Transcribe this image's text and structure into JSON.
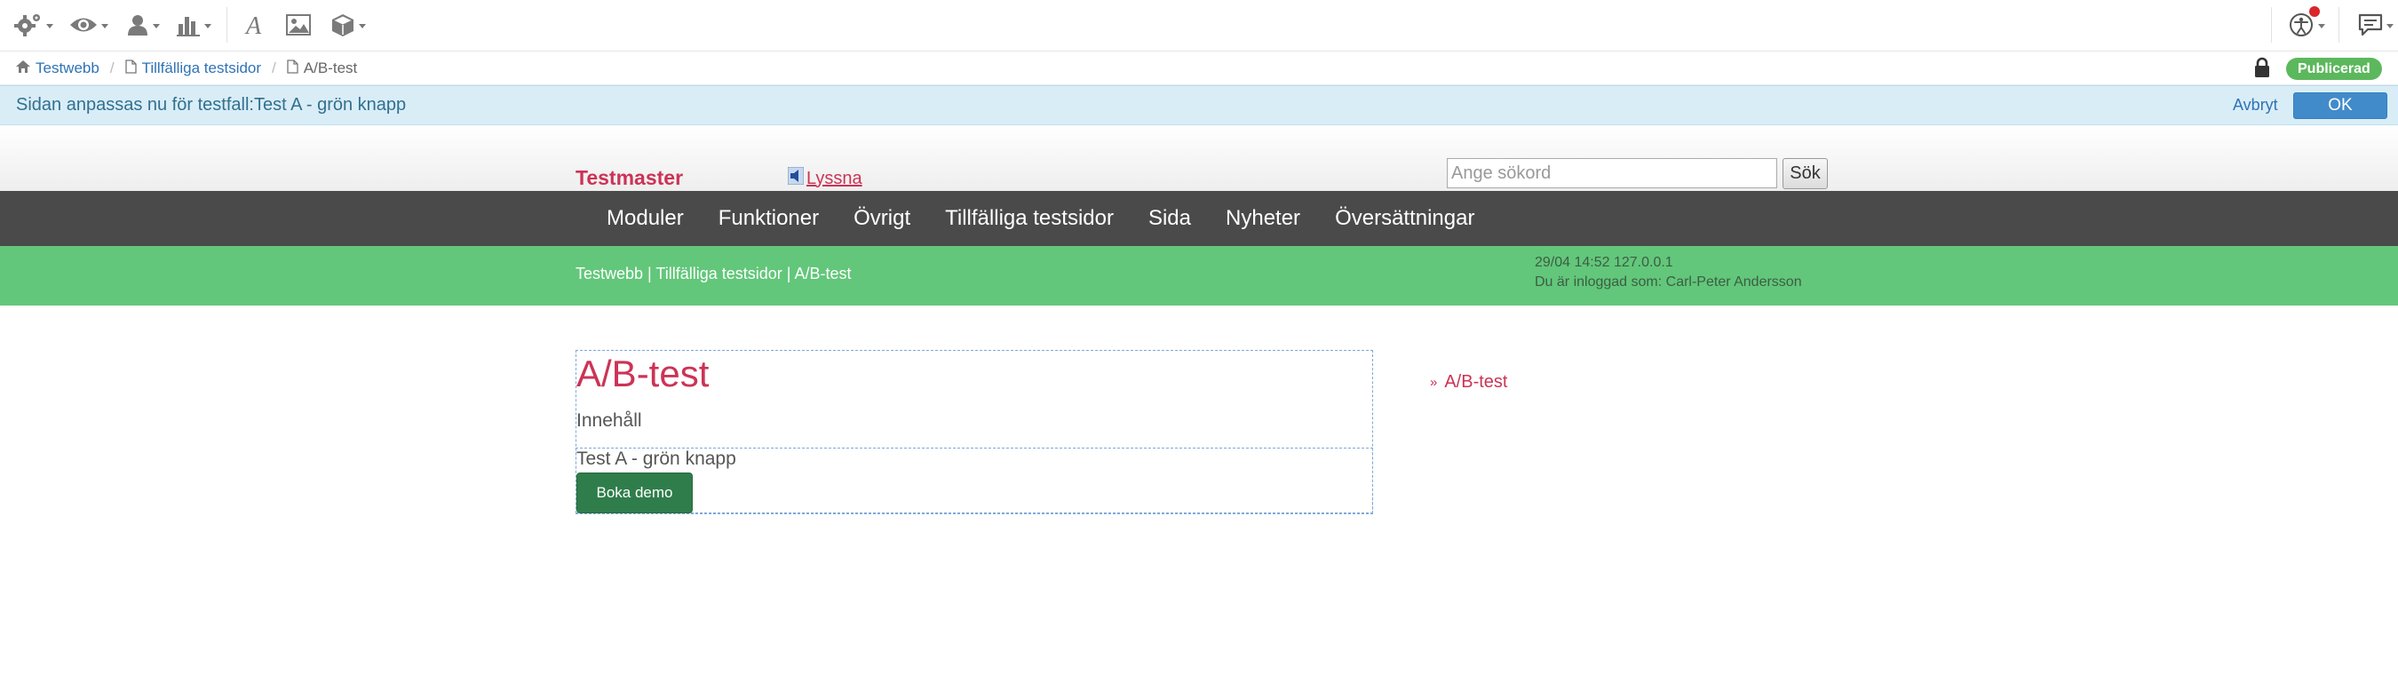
{
  "toolbar": {
    "icons": [
      "gear-icon",
      "eye-icon",
      "user-icon",
      "bar-chart-icon",
      "font-icon",
      "image-icon",
      "cube-icon",
      "accessibility-icon",
      "comment-icon"
    ]
  },
  "breadcrumb": {
    "items": [
      "Testwebb",
      "Tillfälliga testsidor",
      "A/B-test"
    ],
    "status": "Publicerad"
  },
  "infobar": {
    "message": "Sidan anpassas nu för testfall:Test A - grön knapp",
    "cancel": "Avbryt",
    "ok": "OK"
  },
  "header": {
    "logo": "Testmaster",
    "listen": "Lyssna",
    "search_placeholder": "Ange sökord",
    "search_button": "Sök"
  },
  "nav": {
    "items": [
      "Moduler",
      "Funktioner",
      "Övrigt",
      "Tillfälliga testsidor",
      "Sida",
      "Nyheter",
      "Översättningar"
    ]
  },
  "band": {
    "path": "Testwebb | Tillfälliga testsidor | A/B-test",
    "datetime": "29/04 14:52 127.0.0.1",
    "logged_in": "Du är inloggad som: Carl-Peter Andersson"
  },
  "content": {
    "title": "A/B-test",
    "subhead": "Innehåll",
    "test_label": "Test A - grön knapp",
    "button": "Boka demo"
  },
  "sidebar": {
    "link": "A/B-test"
  },
  "colors": {
    "accent": "#cc3355",
    "nav_bg": "#4a4a4a",
    "band_bg": "#62c77a",
    "info_bg": "#d9edf7",
    "demo_button": "#2f7d4b"
  }
}
